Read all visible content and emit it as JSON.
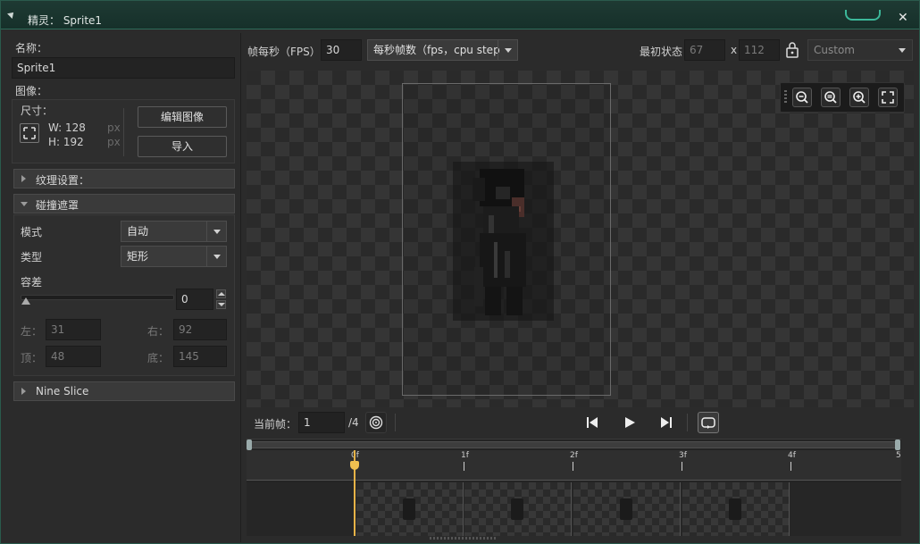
{
  "window": {
    "title": "精灵：  Sprite1"
  },
  "left": {
    "name_label": "名称：",
    "name_value": "Sprite1",
    "image_label": "图像：",
    "size_label": "尺寸：",
    "width_text": "W: 128",
    "height_text": "H: 192",
    "px1": "px",
    "px2": "px",
    "edit_image": "编辑图像",
    "import": "导入",
    "texture_section": "纹理设置：",
    "collision_section": "碰撞遮罩",
    "mode_label": "模式",
    "mode_value": "自动",
    "type_label": "类型",
    "type_value": "矩形",
    "tolerance_label": "容差",
    "tolerance_value": "0",
    "left_label": "左：",
    "left_value": "31",
    "right_label": "右：",
    "right_value": "92",
    "top_label": "顶：",
    "top_value": "48",
    "bottom_label": "底：",
    "bottom_value": "145",
    "nine_slice": "Nine Slice"
  },
  "toolbar": {
    "fps_label": "帧每秒（FPS）",
    "fps_value": "30",
    "fps_mode": "每秒帧数（fps，cpu step",
    "origin_label": "最初状态",
    "origin_x": "67",
    "x_sep": "x",
    "origin_y": "112",
    "origin_preset": "Custom"
  },
  "playback": {
    "current_frame_label": "当前帧：",
    "current_frame_value": "1",
    "total_frames": "/4"
  },
  "timeline": {
    "ticks": [
      "0f",
      "1f",
      "2f",
      "3f",
      "4f",
      "5"
    ]
  },
  "colors": {
    "accent": "#3cb89a",
    "playhead": "#e6b347"
  }
}
